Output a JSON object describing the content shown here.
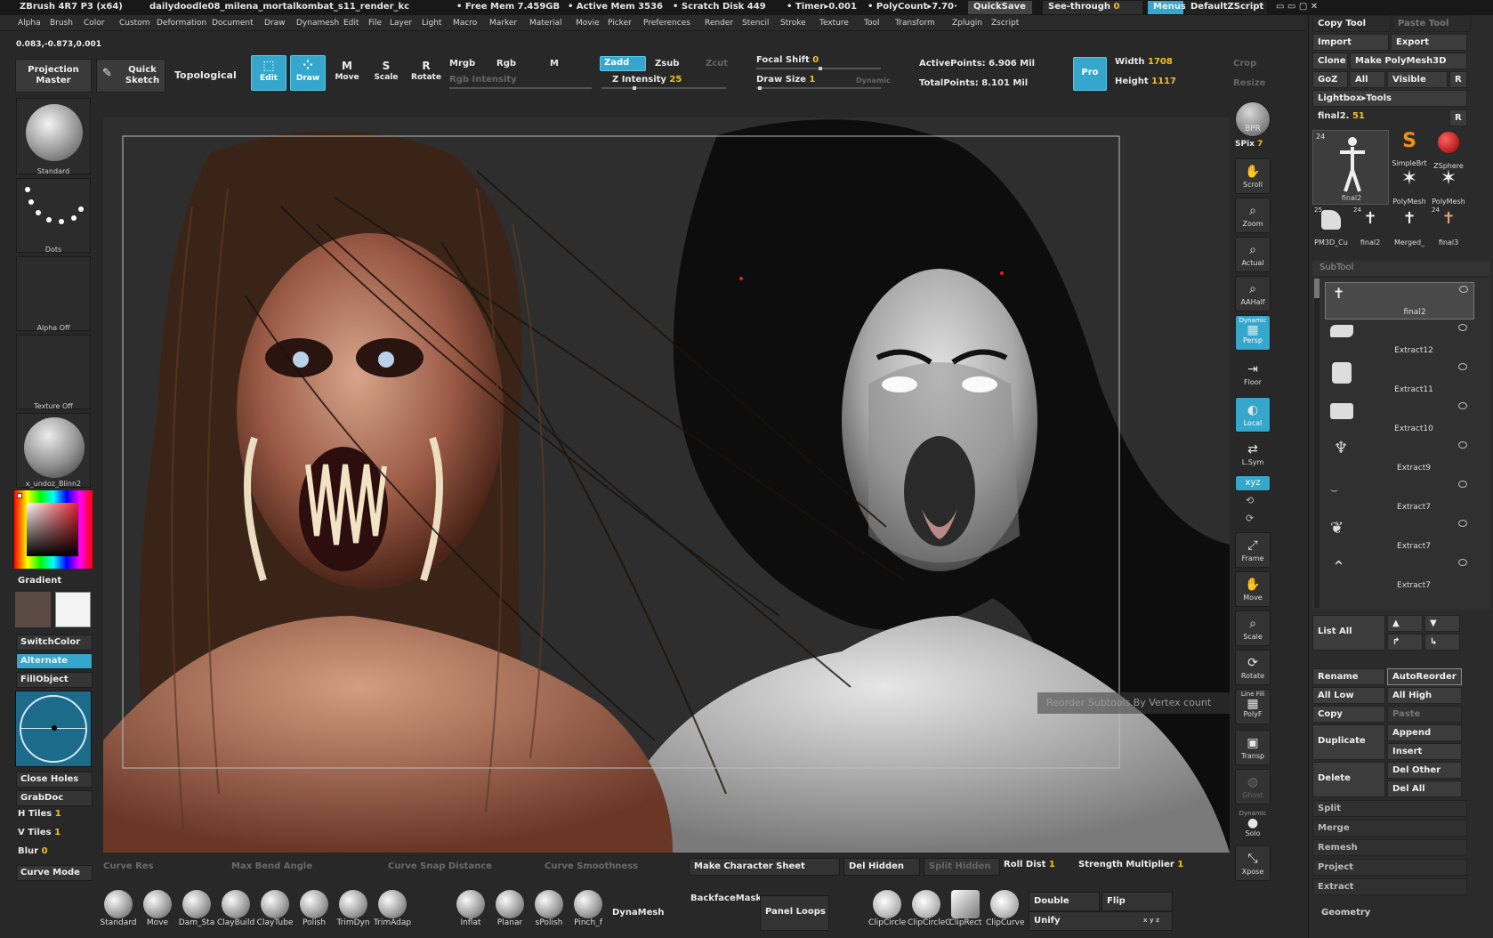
{
  "titlebar": {
    "app": "ZBrush 4R7 P3 (x64)",
    "document": "dailydoodle08_milena_mortalkombat_s11_render_kc",
    "free_mem": "• Free Mem 7.459GB",
    "active_mem": "• Active Mem 3536",
    "scratch": "• Scratch Disk 449",
    "timer": "• Timer▸0.001",
    "polycount": "• PolyCount▸7.70·",
    "quicksave": "QuickSave",
    "see_through_label": "See-through",
    "see_through_value": "0",
    "menus": "Menus",
    "script": "DefaultZScript"
  },
  "menu": [
    "Alpha",
    "Brush",
    "Color",
    "Custom",
    "Deformation",
    "Document",
    "Draw",
    "Dynamesh",
    "Edit",
    "File",
    "Layer",
    "Light",
    "Macro",
    "Marker",
    "Material",
    "Movie",
    "Picker",
    "Preferences",
    "Render",
    "Stencil",
    "Stroke",
    "Texture",
    "Tool",
    "Transform",
    "Zplugin",
    "Zscript"
  ],
  "coords": "0.083,-0.873,0.001",
  "shelf": {
    "projection_master": "Projection Master",
    "quick_sketch": "Quick Sketch",
    "topological": "Topological",
    "edit": "Edit",
    "draw": "Draw",
    "move": "Move",
    "scale": "Scale",
    "rotate": "Rotate",
    "mrgb": "Mrgb",
    "rgb": "Rgb",
    "m": "M",
    "zadd": "Zadd",
    "zsub": "Zsub",
    "zcut": "Zcut",
    "rgb_intensity": "Rgb Intensity",
    "z_intensity_label": "Z Intensity",
    "z_intensity_value": "25",
    "focal_shift_label": "Focal Shift",
    "focal_shift_value": "0",
    "draw_size_label": "Draw Size",
    "draw_size_value": "1",
    "dynamic": "Dynamic",
    "active_points": "ActivePoints: 6.906  Mil",
    "total_points": "TotalPoints: 8.101  Mil",
    "pro": "Pro",
    "width_label": "Width",
    "width_value": "1708",
    "height_label": "Height",
    "height_value": "1117",
    "crop": "Crop",
    "resize": "Resize"
  },
  "left": {
    "brush": "Standard",
    "stroke": "Dots",
    "alpha": "Alpha  Off",
    "texture": "Texture  Off",
    "material": "x_undoz_Blinn2",
    "gradient": "Gradient",
    "switch_color": "SwitchColor",
    "alternate": "Alternate",
    "fill_object": "FillObject",
    "close_holes": "Close Holes",
    "grabdoc": "GrabDoc",
    "h_tiles_label": "H Tiles",
    "h_tiles_value": "1",
    "v_tiles_label": "V Tiles",
    "v_tiles_value": "1",
    "blur_label": "Blur",
    "blur_value": "0",
    "curve_mode": "Curve Mode",
    "primary_color": "#5a4a44",
    "secondary_color": "#f4f4f4"
  },
  "rstrip": [
    {
      "label": "BPR",
      "icon": "bpr-icon"
    },
    {
      "label": "Scroll",
      "icon": "scroll-icon"
    },
    {
      "label": "Zoom",
      "icon": "zoom-icon"
    },
    {
      "label": "Actual",
      "icon": "actual-icon"
    },
    {
      "label": "AAHalf",
      "icon": "aahalf-icon"
    },
    {
      "label": "Persp",
      "icon": "persp-icon",
      "top": "Dynamic"
    },
    {
      "label": "Floor",
      "icon": "floor-icon"
    },
    {
      "label": "Local",
      "icon": "local-icon"
    },
    {
      "label": "L.Sym",
      "icon": "lsym-icon"
    },
    {
      "label": "Frame",
      "icon": "frame-icon"
    },
    {
      "label": "Move",
      "icon": "move-icon"
    },
    {
      "label": "Scale",
      "icon": "scale-icon"
    },
    {
      "label": "Rotate",
      "icon": "rotate-icon"
    },
    {
      "label": "PolyF",
      "icon": "polyf-icon",
      "top": "Line Fill"
    },
    {
      "label": "Transp",
      "icon": "transp-icon"
    },
    {
      "label": "Ghost",
      "icon": "ghost-icon"
    },
    {
      "label": "Solo",
      "icon": "solo-icon",
      "top": "Dynamic"
    },
    {
      "label": "Xpose",
      "icon": "xpose-icon"
    }
  ],
  "spix_label": "SPix",
  "spix_value": "7",
  "xyz": "xyz",
  "rpanel": {
    "copy_tool": "Copy Tool",
    "paste_tool": "Paste Tool",
    "import": "Import",
    "export": "Export",
    "clone": "Clone",
    "make_polymesh": "Make PolyMesh3D",
    "goz": "GoZ",
    "all": "All",
    "visible": "Visible",
    "r": "R",
    "lightbox_tools": "Lightbox▸Tools",
    "current_tool": "final2.",
    "current_tool_value": "51",
    "tools": [
      {
        "name": "final2",
        "count": "24"
      },
      {
        "name": "SimpleBrt"
      },
      {
        "name": "ZSphere"
      },
      {
        "name": "PolyMesh"
      },
      {
        "name": "PolyMesh"
      },
      {
        "name": "PM3D_Cu",
        "count": "25"
      },
      {
        "name": "final2",
        "count": "24"
      },
      {
        "name": "Merged_"
      },
      {
        "name": "final3",
        "count": "24"
      }
    ],
    "subtool_title": "SubTool",
    "subtools": [
      "final2",
      "Extract12",
      "Extract11",
      "Extract10",
      "Extract9",
      "Extract7",
      "Extract7",
      "Extract7"
    ],
    "reorder_tooltip": "Reorder Subtools By Vertex count",
    "list_all": "List  All",
    "rename": "Rename",
    "autoreorder": "AutoReorder",
    "all_low": "All  Low",
    "all_high": "All  High",
    "copy": "Copy",
    "paste": "Paste",
    "duplicate": "Duplicate",
    "append": "Append",
    "insert": "Insert",
    "delete": "Delete",
    "del_other": "Del  Other",
    "del_all": "Del  All",
    "split": "Split",
    "merge": "Merge",
    "remesh": "Remesh",
    "project": "Project",
    "extract": "Extract",
    "geometry": "Geometry"
  },
  "bottom": {
    "curve_res": "Curve Res",
    "max_bend": "Max Bend Angle",
    "curve_snap": "Curve Snap Distance",
    "curve_smooth": "Curve Smoothness",
    "make_character_sheet": "Make Character Sheet",
    "del_hidden": "Del Hidden",
    "split_hidden": "Split Hidden",
    "roll_dist_label": "Roll Dist",
    "roll_dist_value": "1",
    "strength_label": "Strength Multiplier",
    "strength_value": "1",
    "brushes": [
      "Standard",
      "Move",
      "Dam_Sta",
      "ClayBuild",
      "ClayTube",
      "Polish",
      "TrimDyn",
      "TrimAdap",
      "Inflat",
      "Planar",
      "sPolish",
      "Pinch_f"
    ],
    "dynamesh": "DynaMesh",
    "backface_mask": "BackfaceMask",
    "panel_loops": "Panel Loops",
    "clip": [
      "ClipCircle",
      "ClipCircleC",
      "ClipRect",
      "ClipCurve"
    ],
    "double": "Double",
    "flip": "Flip",
    "unify": "Unify",
    "xyz": "x y z"
  }
}
